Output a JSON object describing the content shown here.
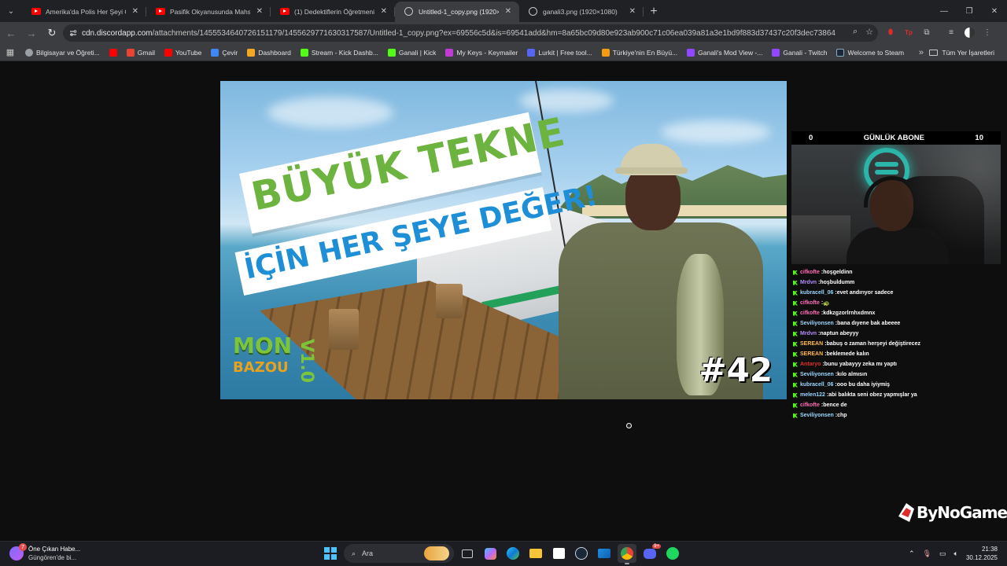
{
  "browser": {
    "tabs": [
      {
        "title": "Amerika'da Polis Her Şeyi Görüyor",
        "icon": "youtube-icon",
        "active": false
      },
      {
        "title": "Pasifik Okyanusunda Mahsur Kalan",
        "icon": "youtube-icon",
        "active": false
      },
      {
        "title": "(1) Dedektiflerin Öğretmenin İçin",
        "icon": "youtube-icon",
        "active": false
      },
      {
        "title": "Untitled-1_copy.png (1920×1080)",
        "icon": "globe-icon",
        "active": true
      },
      {
        "title": "ganali3.png (1920×1080)",
        "icon": "globe-icon",
        "active": false
      }
    ],
    "url_host": "cdn.discordapp.com",
    "url_rest": "/attachments/1455534640726151179/1455629771630317587/Untitled-1_copy.png?ex=69556c5d&is=69541add&hm=8a65bc09d80e923ab900c71c06ea039a81a3e1bd9f883d37437c20f3dec73864",
    "bookmarks": [
      {
        "label": "Bilgisayar ve Öğreti...",
        "color": "#9aa0a6"
      },
      {
        "label": "",
        "color": "#ff0000"
      },
      {
        "label": "Gmail",
        "color": "#ea4335"
      },
      {
        "label": "YouTube",
        "color": "#ff0000"
      },
      {
        "label": "Çevir",
        "color": "#4285f4"
      },
      {
        "label": "Dashboard",
        "color": "#f5a623"
      },
      {
        "label": "Stream - Kick Dashb...",
        "color": "#53fc18"
      },
      {
        "label": "Ganali | Kick",
        "color": "#53fc18"
      },
      {
        "label": "My Keys - Keymailer",
        "color": "#c03bd1"
      },
      {
        "label": "Lurkit | Free tool...",
        "color": "#5865f2"
      },
      {
        "label": "Türkiye'nin En Büyü...",
        "color": "#f39c12"
      },
      {
        "label": "Ganali's Mod View -...",
        "color": "#9146ff"
      },
      {
        "label": "Ganali - Twitch",
        "color": "#9146ff"
      },
      {
        "label": "Welcome to Steam",
        "color": "#1b2838"
      }
    ],
    "all_bookmarks_label": "Tüm Yer İşaretleri"
  },
  "thumbnail": {
    "line1": "BÜYÜK TEKNE",
    "line2": "İÇİN HER ŞEYE DEĞER!",
    "game_mon": "MON",
    "game_bazou": "BAZOU",
    "game_version": "V1.0",
    "episode": "#42"
  },
  "overlay": {
    "sub_min": "0",
    "sub_title": "GÜNLÜK ABONE",
    "sub_max": "10",
    "brand": "ByNoGame",
    "chat": [
      {
        "user": "cifkofte",
        "color": "#ff6bb5",
        "text": "hoşgeldinn"
      },
      {
        "user": "Mrdvn",
        "color": "#b48cff",
        "text": "hoşbuldumm"
      },
      {
        "user": "kubracell_06",
        "color": "#9ad7ff",
        "text": "evet andırıyor sadece"
      },
      {
        "user": "cifkofte",
        "color": "#ff6bb5",
        "text": "🐢"
      },
      {
        "user": "cifkofte",
        "color": "#ff6bb5",
        "text": "kdkzgzorlrnhxdmnx"
      },
      {
        "user": "Seviliyonsen",
        "color": "#9ad7ff",
        "text": "bana dıyene bak abeeee"
      },
      {
        "user": "Mrdvn",
        "color": "#b48cff",
        "text": "naptun abeyyy"
      },
      {
        "user": "SEREAN",
        "color": "#ffb84d",
        "text": "babuş o zaman herşeyi değiştirecez"
      },
      {
        "user": "SEREAN",
        "color": "#ffb84d",
        "text": "beklemede kalın"
      },
      {
        "user": "Antaryo",
        "color": "#e02b2b",
        "text": "bunu yabayyy zeka mı yaptı"
      },
      {
        "user": "Seviliyonsen",
        "color": "#9ad7ff",
        "text": "kılo almısın"
      },
      {
        "user": "kubracell_06",
        "color": "#9ad7ff",
        "text": "ooo bu daha iyiymiş"
      },
      {
        "user": "melen122",
        "color": "#9ad7ff",
        "text": "abi balıkta seni obez yapmışlar ya"
      },
      {
        "user": "cifkofte",
        "color": "#ff6bb5",
        "text": "bence de"
      },
      {
        "user": "Seviliyonsen",
        "color": "#9ad7ff",
        "text": "chp"
      }
    ]
  },
  "taskbar": {
    "news_line1": "Öne Çıkan Habe...",
    "news_line2": "Güngören'de bi...",
    "news_badge": "7",
    "search_placeholder": "Ara",
    "time": "21:38",
    "date": "30.12.2025",
    "discord_badge": "9+"
  }
}
